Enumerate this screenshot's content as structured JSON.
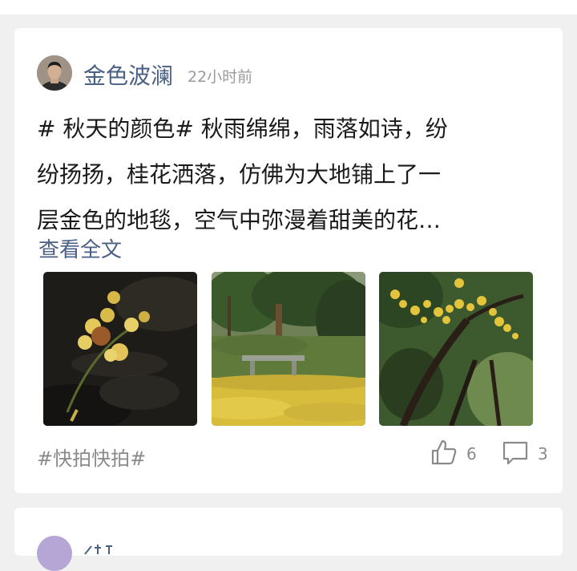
{
  "post": {
    "author": "金色波澜",
    "time": "22小时前",
    "content_lines": [
      "# 秋天的颜色# 秋雨绵绵，雨落如诗，纷",
      "纷扬扬，桂花洒落，仿佛为大地铺上了一",
      "层金色的地毯，空气中弥漫着甜美的花…"
    ],
    "read_more": "查看全文",
    "tag": "#快拍快拍#",
    "likes": "6",
    "comments": "3",
    "images": [
      "osmanthus-closeup",
      "park-bench-yellow-carpet",
      "osmanthus-branch"
    ],
    "icons": {
      "like": "thumbs-up-icon",
      "comment": "comment-icon"
    },
    "colors": {
      "link": "#4a6085",
      "meta": "#9a9a9a",
      "text": "#1a1a1a",
      "background": "#f0f0f0"
    }
  }
}
